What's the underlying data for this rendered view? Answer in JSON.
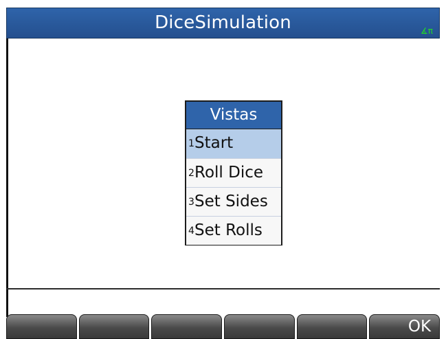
{
  "header": {
    "title": "DiceSimulation",
    "status_icon": "∡π"
  },
  "menu": {
    "title": "Vistas",
    "items": [
      {
        "num": "1",
        "label": "Start"
      },
      {
        "num": "2",
        "label": "Roll Dice"
      },
      {
        "num": "3",
        "label": "Set Sides"
      },
      {
        "num": "4",
        "label": "Set Rolls"
      }
    ],
    "selected_index": 0
  },
  "softkeys": [
    "",
    "",
    "",
    "",
    "",
    "OK"
  ],
  "colors": {
    "title_bar": "#2f64aa",
    "selected_item": "#b5cde9",
    "status_icon": "#22dd22"
  }
}
